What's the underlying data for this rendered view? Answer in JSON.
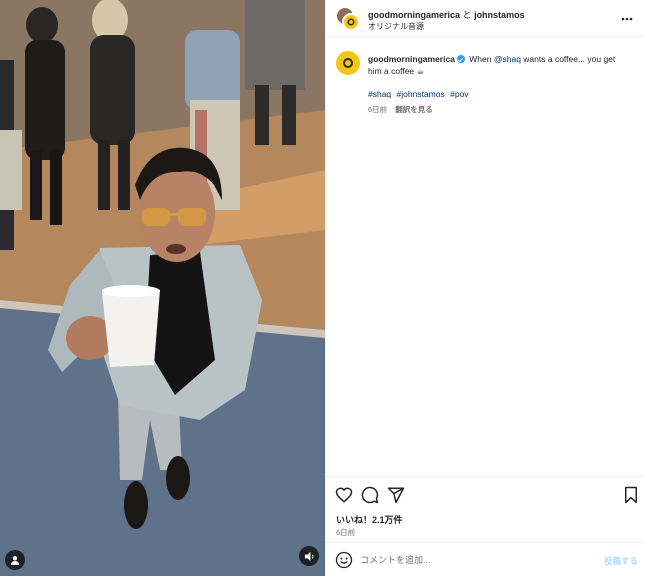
{
  "header": {
    "author_primary": "goodmorningamerica",
    "conjunction": "と",
    "author_secondary": "johnstamos",
    "audio_label": "オリジナル音源"
  },
  "caption": {
    "username": "goodmorningamerica",
    "text_prefix": "When ",
    "mention": "@shaq",
    "text_suffix": " wants a coffee... you get him a coffee ☕",
    "hashtags": [
      "#shaq",
      "#johnstamos",
      "#pov"
    ],
    "age": "6日前",
    "translate_label": "翻訳を見る"
  },
  "actions": {
    "likes": "いいね！2.1万件",
    "date": "6日前"
  },
  "comment": {
    "placeholder": "コメントを追加...",
    "post_label": "投稿する"
  },
  "icons": {
    "like": "heart-icon",
    "comment": "comment-icon",
    "share": "paper-plane-icon",
    "save": "bookmark-icon",
    "emoji": "emoji-icon",
    "more": "more-dots-icon",
    "user_tag": "user-tag-icon",
    "audio": "speaker-icon"
  },
  "colors": {
    "link": "#00376b",
    "verified": "#3897f0",
    "brand_avatar": "#f5c518",
    "muted_text": "#737373",
    "post_button": "#b3dbff"
  }
}
